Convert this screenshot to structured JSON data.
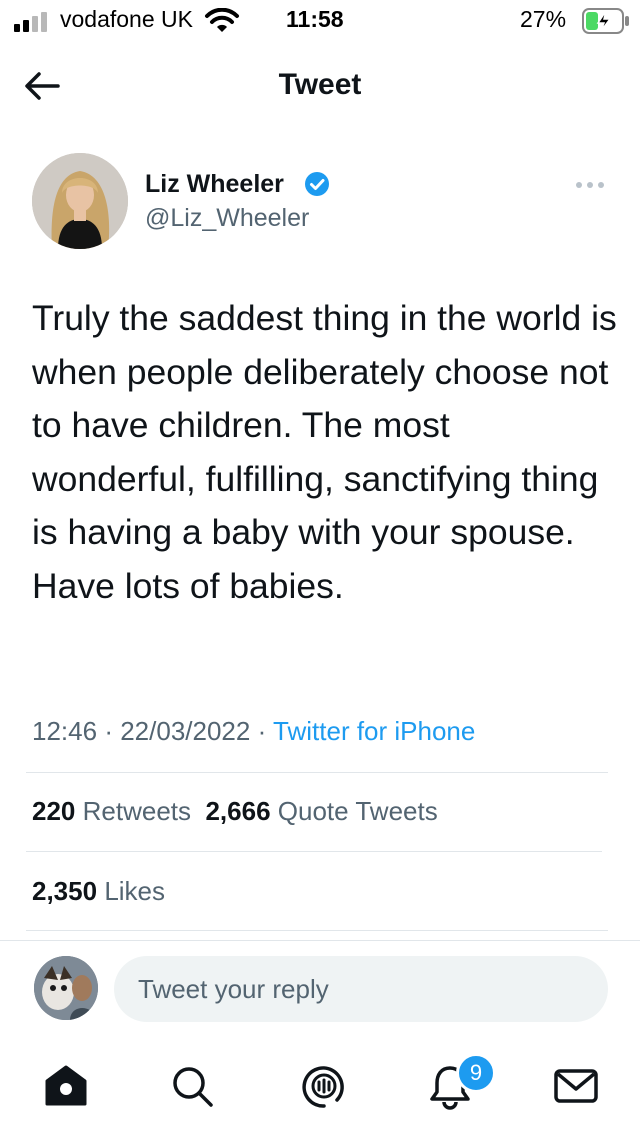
{
  "status_bar": {
    "carrier": "vodafone UK",
    "time": "11:58",
    "battery": "27%"
  },
  "header": {
    "title": "Tweet"
  },
  "tweet": {
    "author_name": "Liz Wheeler",
    "handle": "@Liz_Wheeler",
    "verified": true,
    "text": "Truly the saddest thing in the world is when people deliberately choose not to have children. The most wonderful, fulfilling, sanctifying thing is having a baby with your spouse. Have lots of babies.",
    "time": "12:46",
    "date": "22/03/2022",
    "source": "Twitter for iPhone",
    "separator": "·"
  },
  "stats": {
    "retweets_count": "220",
    "retweets_label": "Retweets",
    "quote_tweets_count": "2,666",
    "quote_tweets_label": "Quote Tweets",
    "likes_count": "2,350",
    "likes_label": "Likes"
  },
  "reply": {
    "placeholder": "Tweet your reply"
  },
  "tab_bar": {
    "items": [
      "home-icon",
      "search-icon",
      "spaces-icon",
      "notifications-icon",
      "messages-icon"
    ],
    "notifications_badge": "9"
  },
  "colors": {
    "accent": "#1d9bf0",
    "text_primary": "#0f1419",
    "text_secondary": "#536471",
    "divider": "#e1e6ea",
    "reply_bg": "#eff3f4"
  }
}
